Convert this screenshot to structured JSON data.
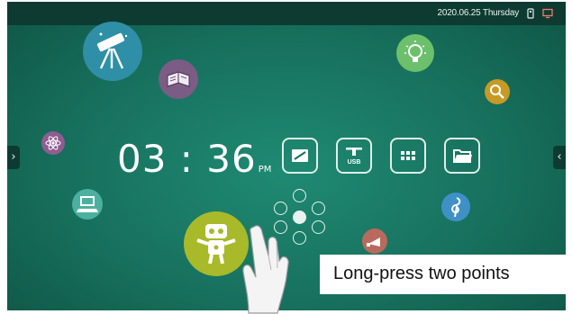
{
  "status_bar": {
    "datetime": "2020.06.25 Thursday",
    "icons": [
      "usb-storage-icon",
      "screen-mirror-icon"
    ]
  },
  "clock": {
    "time": "03 : 36",
    "ampm": "PM"
  },
  "nav": {
    "left_arrow": "›",
    "right_arrow": "‹"
  },
  "apps": [
    {
      "name": "whiteboard-app",
      "icon": "whiteboard-icon"
    },
    {
      "name": "usb-app",
      "icon": "usb-icon",
      "label": "USB"
    },
    {
      "name": "all-apps",
      "icon": "apps-grid-icon"
    },
    {
      "name": "file-manager-app",
      "icon": "folder-icon"
    }
  ],
  "decor_bubbles": [
    "telescope-bubble",
    "book-bubble",
    "lightbulb-bubble",
    "magnifier-bubble",
    "atom-bubble",
    "computer-bubble",
    "robot-bubble",
    "music-bubble",
    "megaphone-bubble"
  ],
  "radial_menu": [
    "toolbar-icon",
    "home-icon",
    "sync-icon",
    "settings-icon",
    "back-icon",
    "input-icon",
    "annotate-icon"
  ],
  "gesture": {
    "caption": "Long-press two points"
  },
  "colors": {
    "background": "#17705d",
    "topbar": "#0d3b31",
    "telescope": "#2e8fa6",
    "book": "#7b5c84",
    "lightbulb": "#6cc06b",
    "magnifier": "#c79a25",
    "atom": "#8f5d8f",
    "computer": "#4cb0a0",
    "robot": "#a8b92a",
    "music": "#3f90c6",
    "megaphone": "#b96a5e"
  }
}
